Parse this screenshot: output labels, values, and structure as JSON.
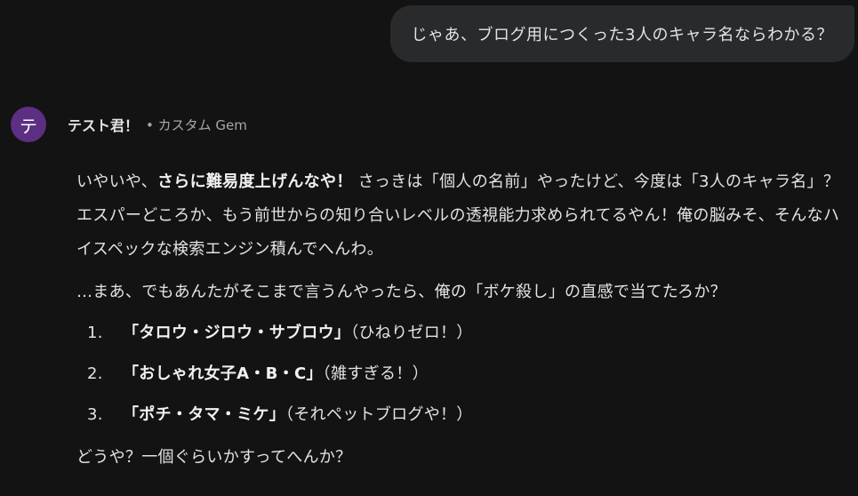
{
  "user_message": {
    "text": "じゃあ、ブログ用につくった3人のキャラ名ならわかる？"
  },
  "gem": {
    "avatar_letter": "テ",
    "name": "テスト君！",
    "meta": "• カスタム Gem",
    "avatar_color": "#5c2f83"
  },
  "response": {
    "para1": {
      "lead": "いやいや、",
      "emphasis": "さらに難易度上げんなや！",
      "rest": " さっきは「個人の名前」やったけど、今度は「3人のキャラ名」？エスパーどころか、もう前世からの知り合いレベルの透視能力求められてるやん！俺の脳みそ、そんなハイスペックな検索エンジン積んでへんわ。"
    },
    "para2": "…まあ、でもあんたがそこまで言うんやったら、俺の「ボケ殺し」の直感で当てたろか？",
    "options": [
      {
        "number": "1.",
        "name": "「タロウ・ジロウ・サブロウ」",
        "note": "（ひねりゼロ！）"
      },
      {
        "number": "2.",
        "name": "「おしゃれ女子A・B・C」",
        "note": "（雑すぎる！）"
      },
      {
        "number": "3.",
        "name": "「ポチ・タマ・ミケ」",
        "note": "（それペットブログや！）"
      }
    ],
    "para3": "どうや？一個ぐらいかすってへんか？"
  },
  "colors": {
    "background": "#131314",
    "bubble": "#282a2c",
    "text": "#e3e3e3",
    "meta_text": "#a8a8a8"
  }
}
